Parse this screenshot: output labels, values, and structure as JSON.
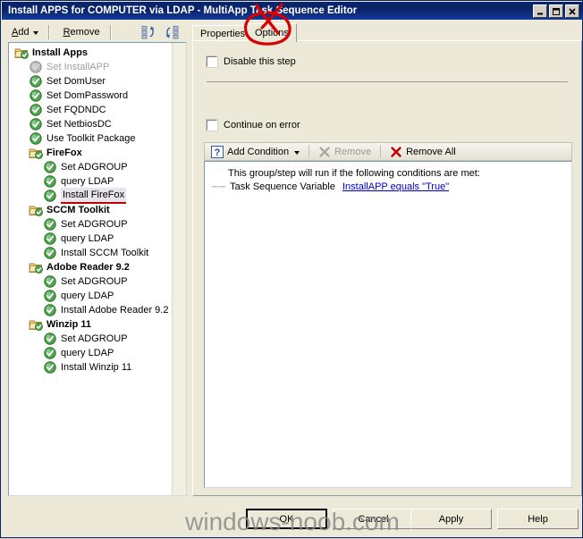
{
  "window": {
    "title": "Install APPS for COMPUTER via LDAP - MultiApp Task Sequence Editor",
    "minimize_label": "minimize",
    "maximize_label": "maximize",
    "close_label": "close"
  },
  "left_toolbar": {
    "add_label": "Add",
    "remove_label": "Remove",
    "move_up_icon": "move-up-icon",
    "move_down_icon": "move-down-icon"
  },
  "tree": {
    "items": [
      {
        "label": "Install Apps",
        "level": 1,
        "type": "group",
        "state": "normal"
      },
      {
        "label": "Set InstallAPP",
        "level": 2,
        "type": "step",
        "state": "disabled"
      },
      {
        "label": "Set DomUser",
        "level": 2,
        "type": "step",
        "state": "normal"
      },
      {
        "label": "Set DomPassword",
        "level": 2,
        "type": "step",
        "state": "normal"
      },
      {
        "label": "Set FQDNDC",
        "level": 2,
        "type": "step",
        "state": "normal"
      },
      {
        "label": "Set NetbiosDC",
        "level": 2,
        "type": "step",
        "state": "normal"
      },
      {
        "label": "Use Toolkit Package",
        "level": 2,
        "type": "step",
        "state": "normal"
      },
      {
        "label": "FireFox",
        "level": 2,
        "type": "group",
        "state": "normal"
      },
      {
        "label": "Set ADGROUP",
        "level": 3,
        "type": "step",
        "state": "normal"
      },
      {
        "label": "query LDAP",
        "level": 3,
        "type": "step",
        "state": "normal"
      },
      {
        "label": "Install FireFox",
        "level": 3,
        "type": "step",
        "state": "selected"
      },
      {
        "label": "SCCM Toolkit",
        "level": 2,
        "type": "group",
        "state": "normal"
      },
      {
        "label": "Set ADGROUP",
        "level": 3,
        "type": "step",
        "state": "normal"
      },
      {
        "label": "query LDAP",
        "level": 3,
        "type": "step",
        "state": "normal"
      },
      {
        "label": "Install SCCM Toolkit",
        "level": 3,
        "type": "step",
        "state": "normal"
      },
      {
        "label": "Adobe Reader 9.2",
        "level": 2,
        "type": "group",
        "state": "normal"
      },
      {
        "label": "Set ADGROUP",
        "level": 3,
        "type": "step",
        "state": "normal"
      },
      {
        "label": "query LDAP",
        "level": 3,
        "type": "step",
        "state": "normal"
      },
      {
        "label": "Install Adobe Reader 9.2",
        "level": 3,
        "type": "step",
        "state": "normal"
      },
      {
        "label": "Winzip 11",
        "level": 2,
        "type": "group",
        "state": "normal"
      },
      {
        "label": "Set ADGROUP",
        "level": 3,
        "type": "step",
        "state": "normal"
      },
      {
        "label": "query LDAP",
        "level": 3,
        "type": "step",
        "state": "normal"
      },
      {
        "label": "Install Winzip 11",
        "level": 3,
        "type": "step",
        "state": "normal"
      }
    ]
  },
  "tabs": {
    "properties_label": "Properties",
    "options_label": "Options",
    "active": "Options"
  },
  "options": {
    "disable_step_label": "Disable this step",
    "disable_step_checked": false,
    "continue_on_error_label": "Continue on error",
    "continue_on_error_checked": false,
    "condition_toolbar": {
      "add_condition_label": "Add Condition",
      "remove_label": "Remove",
      "remove_all_label": "Remove All",
      "remove_enabled": false
    },
    "condition_list": {
      "header": "This group/step will run if the following conditions are met:",
      "rows": [
        {
          "prefix": "Task Sequence Variable",
          "link": "InstallAPP equals \"True\""
        }
      ]
    }
  },
  "buttons": {
    "ok": "OK",
    "cancel": "Cancel",
    "apply": "Apply",
    "help": "Help"
  },
  "watermark": {
    "text": "windows-noob.com"
  },
  "colors": {
    "titlebar": "#0a246a",
    "face": "#ece9d8",
    "link": "#0000cc",
    "annotation": "#d80000",
    "check_green": "#4ea64e",
    "folder_yellow": "#f5d680"
  }
}
